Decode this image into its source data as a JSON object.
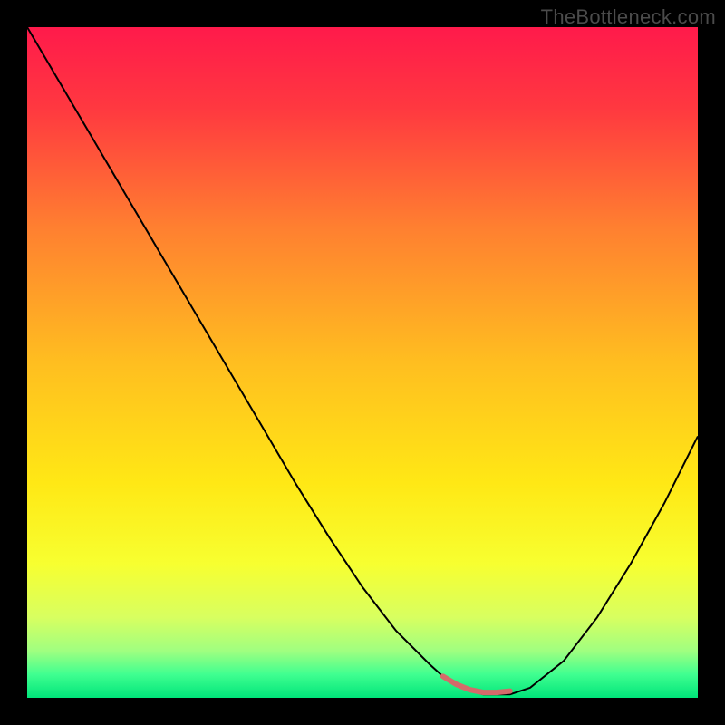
{
  "watermark": "TheBottleneck.com",
  "chart_data": {
    "type": "line",
    "title": "",
    "xlabel": "",
    "ylabel": "",
    "xlim": [
      0,
      100
    ],
    "ylim": [
      0,
      100
    ],
    "background_gradient": {
      "stops": [
        {
          "offset": 0.0,
          "color": "#ff1a4b"
        },
        {
          "offset": 0.12,
          "color": "#ff3840"
        },
        {
          "offset": 0.3,
          "color": "#ff8030"
        },
        {
          "offset": 0.5,
          "color": "#ffbe20"
        },
        {
          "offset": 0.68,
          "color": "#ffe815"
        },
        {
          "offset": 0.8,
          "color": "#f7ff30"
        },
        {
          "offset": 0.88,
          "color": "#d8ff60"
        },
        {
          "offset": 0.93,
          "color": "#a0ff80"
        },
        {
          "offset": 0.965,
          "color": "#40ff90"
        },
        {
          "offset": 1.0,
          "color": "#00e57a"
        }
      ]
    },
    "series": [
      {
        "name": "bottleneck-curve",
        "color": "#000000",
        "stroke_width": 2,
        "x": [
          0,
          5,
          10,
          15,
          20,
          25,
          30,
          35,
          40,
          45,
          50,
          55,
          60,
          62,
          65,
          68,
          72,
          75,
          80,
          85,
          90,
          95,
          100
        ],
        "y": [
          100,
          91.5,
          83,
          74.5,
          66,
          57.5,
          49,
          40.5,
          32,
          24,
          16.5,
          10,
          5,
          3.2,
          1.4,
          0.5,
          0.5,
          1.5,
          5.5,
          12,
          20,
          29,
          39
        ]
      }
    ],
    "highlight": {
      "name": "optimal-range",
      "color": "#d46a6a",
      "stroke_width": 6,
      "x": [
        62,
        64,
        66,
        68,
        70,
        72
      ],
      "y": [
        3.2,
        2.0,
        1.2,
        0.8,
        0.8,
        1.0
      ]
    }
  }
}
